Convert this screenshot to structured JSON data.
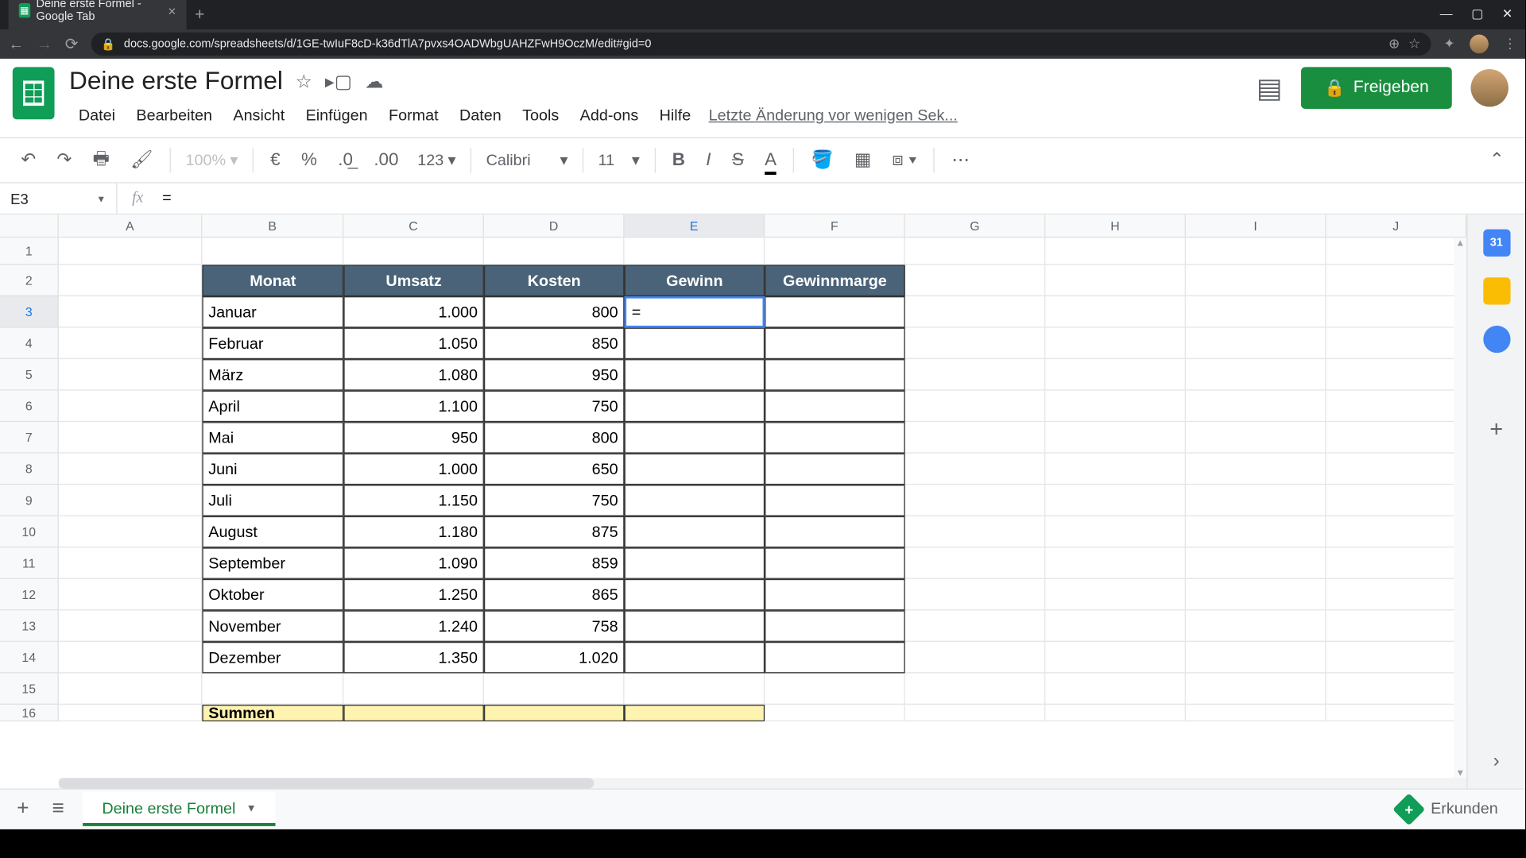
{
  "browser": {
    "tab_title": "Deine erste Formel - Google Tab",
    "url": "docs.google.com/spreadsheets/d/1GE-twIuF8cD-k36dTlA7pvxs4OADWbgUAHZFwH9OczM/edit#gid=0"
  },
  "doc": {
    "title": "Deine erste Formel",
    "last_edit": "Letzte Änderung vor wenigen Sek..."
  },
  "menu": {
    "file": "Datei",
    "edit": "Bearbeiten",
    "view": "Ansicht",
    "insert": "Einfügen",
    "format": "Format",
    "data": "Daten",
    "tools": "Tools",
    "addons": "Add-ons",
    "help": "Hilfe"
  },
  "share": {
    "label": "Freigeben"
  },
  "toolbar": {
    "zoom": "100%",
    "num_format": "123",
    "font": "Calibri",
    "font_size": "11"
  },
  "name_box": "E3",
  "formula": "=",
  "columns": [
    "A",
    "B",
    "C",
    "D",
    "E",
    "F",
    "G",
    "H",
    "I",
    "J"
  ],
  "headers": {
    "b": "Monat",
    "c": "Umsatz",
    "d": "Kosten",
    "e": "Gewinn",
    "f": "Gewinnmarge"
  },
  "active_cell_value": "=",
  "table": [
    {
      "m": "Januar",
      "u": "1.000",
      "k": "800"
    },
    {
      "m": "Februar",
      "u": "1.050",
      "k": "850"
    },
    {
      "m": "März",
      "u": "1.080",
      "k": "950"
    },
    {
      "m": "April",
      "u": "1.100",
      "k": "750"
    },
    {
      "m": "Mai",
      "u": "950",
      "k": "800"
    },
    {
      "m": "Juni",
      "u": "1.000",
      "k": "650"
    },
    {
      "m": "Juli",
      "u": "1.150",
      "k": "750"
    },
    {
      "m": "August",
      "u": "1.180",
      "k": "875"
    },
    {
      "m": "September",
      "u": "1.090",
      "k": "859"
    },
    {
      "m": "Oktober",
      "u": "1.250",
      "k": "865"
    },
    {
      "m": "November",
      "u": "1.240",
      "k": "758"
    },
    {
      "m": "Dezember",
      "u": "1.350",
      "k": "1.020"
    }
  ],
  "summen_label": "Summen",
  "sheet_tab": "Deine erste Formel",
  "explore": "Erkunden",
  "side_cal": "31"
}
